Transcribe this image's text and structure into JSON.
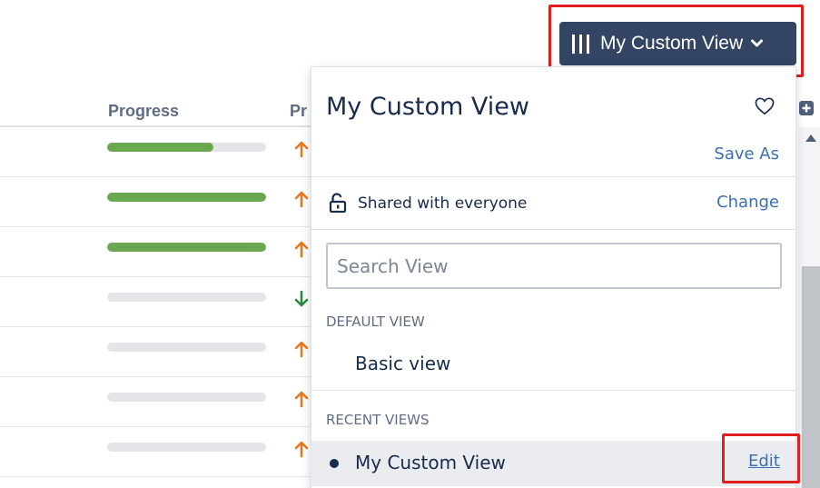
{
  "header": {
    "view_button_label": "My Custom View"
  },
  "table": {
    "columns": {
      "progress": "Progress",
      "priority_partial": "Pr"
    },
    "rows": [
      {
        "progress": 0.67,
        "priority": "up"
      },
      {
        "progress": 1.0,
        "priority": "up"
      },
      {
        "progress": 1.0,
        "priority": "up"
      },
      {
        "progress": 0,
        "priority": "down"
      },
      {
        "progress": 0,
        "priority": "up"
      },
      {
        "progress": 0,
        "priority": "up"
      },
      {
        "progress": 0,
        "priority": "up"
      }
    ]
  },
  "dropdown": {
    "title": "My Custom View",
    "save_as": "Save As",
    "sharing": "Shared with everyone",
    "change": "Change",
    "search_placeholder": "Search View",
    "default_section": "DEFAULT VIEW",
    "default_views": [
      "Basic view"
    ],
    "recent_section": "RECENT VIEWS",
    "recent_views": [
      {
        "name": "My Custom View",
        "action": "Edit"
      }
    ]
  },
  "colors": {
    "progress_fill": "#6aa84f",
    "progress_track": "#e3e5e8",
    "priority_up": "#e8781e",
    "priority_down": "#2b8a3e",
    "button_bg": "#344563",
    "highlight": "#e01e1e",
    "link": "#3d6fb0"
  },
  "icons": [
    "columns-icon",
    "chevron-down-icon",
    "heart-icon",
    "unlock-icon",
    "arrow-up-icon",
    "arrow-down-icon",
    "add-column-icon",
    "scroll-up-icon"
  ]
}
